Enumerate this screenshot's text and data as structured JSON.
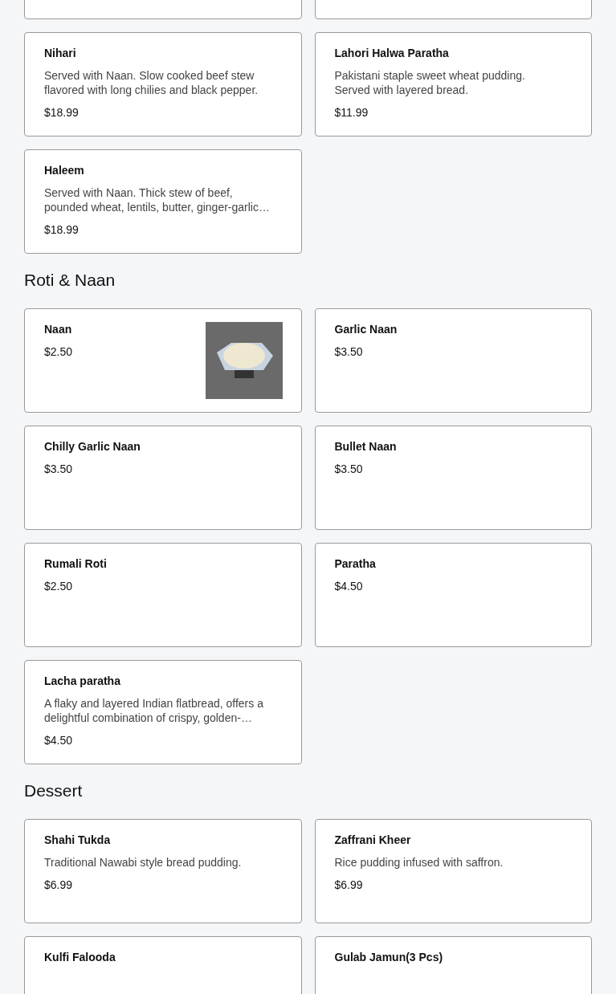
{
  "sections": [
    {
      "items": [
        {
          "name": "Nihari",
          "description": "Served with Naan. Slow cooked beef stew flavored with long chilies and black pepper.",
          "price": "$18.99",
          "has_photo": false
        },
        {
          "name": "Lahori Halwa Paratha",
          "description": "Pakistani staple sweet wheat pudding. Served with layered bread.",
          "price": "$11.99",
          "has_photo": false
        },
        {
          "name": "Haleem",
          "description": "Served with Naan. Thick stew of beef, pounded wheat, lentils, butter, ginger-garlic…",
          "price": "$18.99",
          "has_photo": false
        }
      ]
    },
    {
      "title": "Roti & Naan",
      "items": [
        {
          "name": "Naan",
          "price": "$2.50",
          "has_photo": true
        },
        {
          "name": "Garlic Naan",
          "price": "$3.50",
          "has_photo": false
        },
        {
          "name": "Chilly Garlic Naan",
          "price": "$3.50",
          "has_photo": false
        },
        {
          "name": "Bullet Naan",
          "price": "$3.50",
          "has_photo": false
        },
        {
          "name": "Rumali Roti",
          "price": "$2.50",
          "has_photo": false
        },
        {
          "name": "Paratha",
          "price": "$4.50",
          "has_photo": false
        },
        {
          "name": "Lacha paratha",
          "description": "A flaky and layered Indian flatbread, offers a delightful combination of crispy, golden-…",
          "price": "$4.50",
          "has_photo": false
        }
      ]
    },
    {
      "title": "Dessert",
      "items": [
        {
          "name": "Shahi Tukda",
          "description": "Traditional Nawabi style bread pudding.",
          "price": "$6.99",
          "has_photo": false
        },
        {
          "name": "Zaffrani Kheer",
          "description": "Rice pudding infused with saffron.",
          "price": "$6.99",
          "has_photo": false
        },
        {
          "name": "Kulfi Falooda",
          "has_photo": false
        },
        {
          "name": "Gulab Jamun(3 Pcs)",
          "has_photo": false
        }
      ]
    }
  ]
}
